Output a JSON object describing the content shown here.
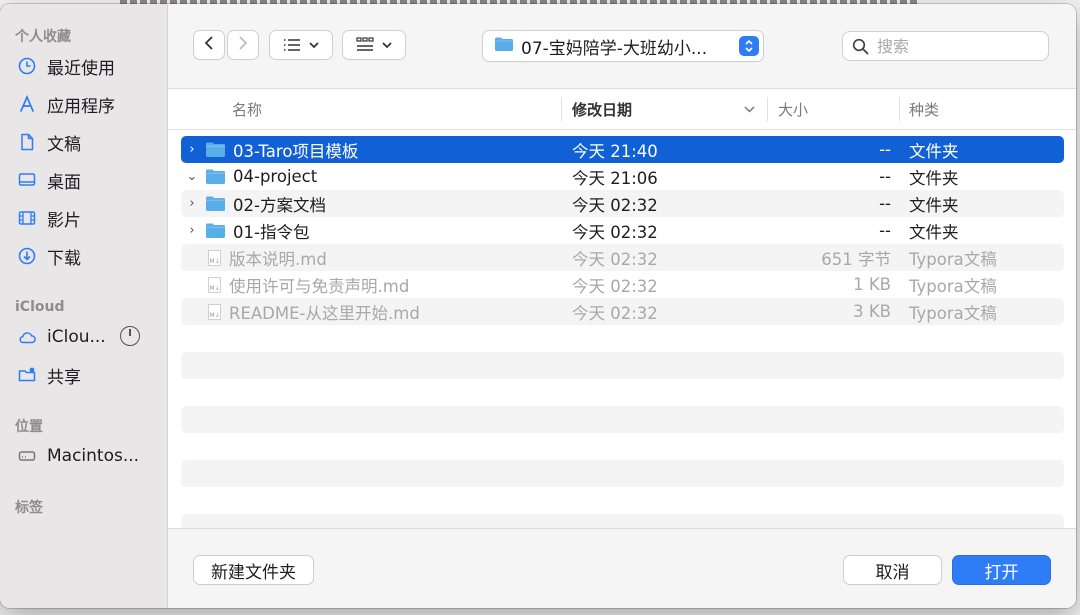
{
  "sidebar": {
    "favorites_title": "个人收藏",
    "favorites": [
      {
        "label": "最近使用",
        "icon": "clock-icon"
      },
      {
        "label": "应用程序",
        "icon": "applications-icon"
      },
      {
        "label": "文稿",
        "icon": "document-icon"
      },
      {
        "label": "桌面",
        "icon": "desktop-icon"
      },
      {
        "label": "影片",
        "icon": "film-icon"
      },
      {
        "label": "下载",
        "icon": "download-icon"
      }
    ],
    "icloud_title": "iCloud",
    "icloud": [
      {
        "label": "iClou...",
        "icon": "cloud-icon"
      },
      {
        "label": "共享",
        "icon": "shared-folder-icon"
      }
    ],
    "locations_title": "位置",
    "locations": [
      {
        "label": "Macintos...",
        "icon": "disk-icon"
      }
    ],
    "tags_title": "标签"
  },
  "toolbar": {
    "path_label": "07-宝妈陪学-大班幼小...",
    "search_placeholder": "搜索"
  },
  "columns": {
    "name": "名称",
    "date": "修改日期",
    "size": "大小",
    "kind": "种类"
  },
  "files": [
    {
      "name": "03-Taro项目模板",
      "date": "今天 21:40",
      "size": "--",
      "kind": "文件夹",
      "type": "folder",
      "disclosure": "›"
    },
    {
      "name": "04-project",
      "date": "今天 21:06",
      "size": "--",
      "kind": "文件夹",
      "type": "folder",
      "disclosure": "⌄"
    },
    {
      "name": "02-方案文档",
      "date": "今天 02:32",
      "size": "--",
      "kind": "文件夹",
      "type": "folder",
      "disclosure": "›"
    },
    {
      "name": "01-指令包",
      "date": "今天 02:32",
      "size": "--",
      "kind": "文件夹",
      "type": "folder",
      "disclosure": "›"
    },
    {
      "name": "版本说明.md",
      "date": "今天 02:32",
      "size": "651 字节",
      "kind": "Typora文稿",
      "type": "md"
    },
    {
      "name": "使用许可与免责声明.md",
      "date": "今天 02:32",
      "size": "1 KB",
      "kind": "Typora文稿",
      "type": "md"
    },
    {
      "name": "README-从这里开始.md",
      "date": "今天 02:32",
      "size": "3 KB",
      "kind": "Typora文稿",
      "type": "md"
    }
  ],
  "md_icon_text": "M↓",
  "footer": {
    "new_folder": "新建文件夹",
    "cancel": "取消",
    "open": "打开"
  },
  "colors": {
    "selection": "#1260d6",
    "accent": "#2f7df6",
    "folder": "#5aaee8"
  }
}
